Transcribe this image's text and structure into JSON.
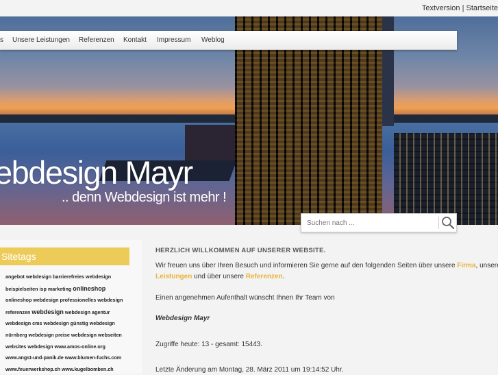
{
  "toplinks": {
    "textversion": "Textversion",
    "separator": "|",
    "startseite": "Startseite"
  },
  "nav": [
    {
      "label": "s"
    },
    {
      "label": "Unsere Leistungen"
    },
    {
      "label": "Referenzen"
    },
    {
      "label": "Kontakt"
    },
    {
      "label": "Impressum"
    },
    {
      "label": "Weblog"
    }
  ],
  "hero": {
    "title": "ebdesign Mayr",
    "subtitle": ".. denn Webdesign ist mehr !"
  },
  "search": {
    "placeholder": "Suchen nach ...",
    "icon": "search-icon"
  },
  "sidebar": {
    "heading": "Sitetags",
    "tag_lines": [
      "angebot webdesign barrierefreies webdesign",
      "beispielseiten isp marketing",
      "onlineshop",
      "onlineshop webdesign professionelles webdesign",
      "referenzen",
      "webdesign",
      "webdesign agentur",
      "webdesign cms webdesign günstig webdesign",
      "nürnberg webdesign preise webdesign webseiten",
      "websites webdesign www.amos-online.org",
      "www.angst-und-panik.de www.blumen-fuchs.com",
      "www.feuerwerkshop.ch www.kugelbomben.ch"
    ]
  },
  "main": {
    "heading": "HERZLICH WILLKOMMEN AUF UNSERER WEBSITE.",
    "p1_a": "Wir freuen uns über Ihren Besuch und informieren Sie gerne auf den folgenden Seiten über unsere",
    "link_firma": "Firma",
    "p1_b": ", unsere",
    "link_leistungen": "Leistungen",
    "p1_c": "und über unsere",
    "link_referenzen": "Referenzen",
    "p1_d": ".",
    "p2": "Einen angenehmen Aufenthalt wünscht Ihnen Ihr Team von",
    "company": "Webdesign Mayr",
    "visits": "Zugriffe heute: 13 - gesamt: 15443.",
    "last_change": "Letzte Änderung am Montag, 28. März 2011 um 19:14:52 Uhr."
  },
  "colors": {
    "accent": "#eab339",
    "sitetags_bg": "#eccb58"
  }
}
